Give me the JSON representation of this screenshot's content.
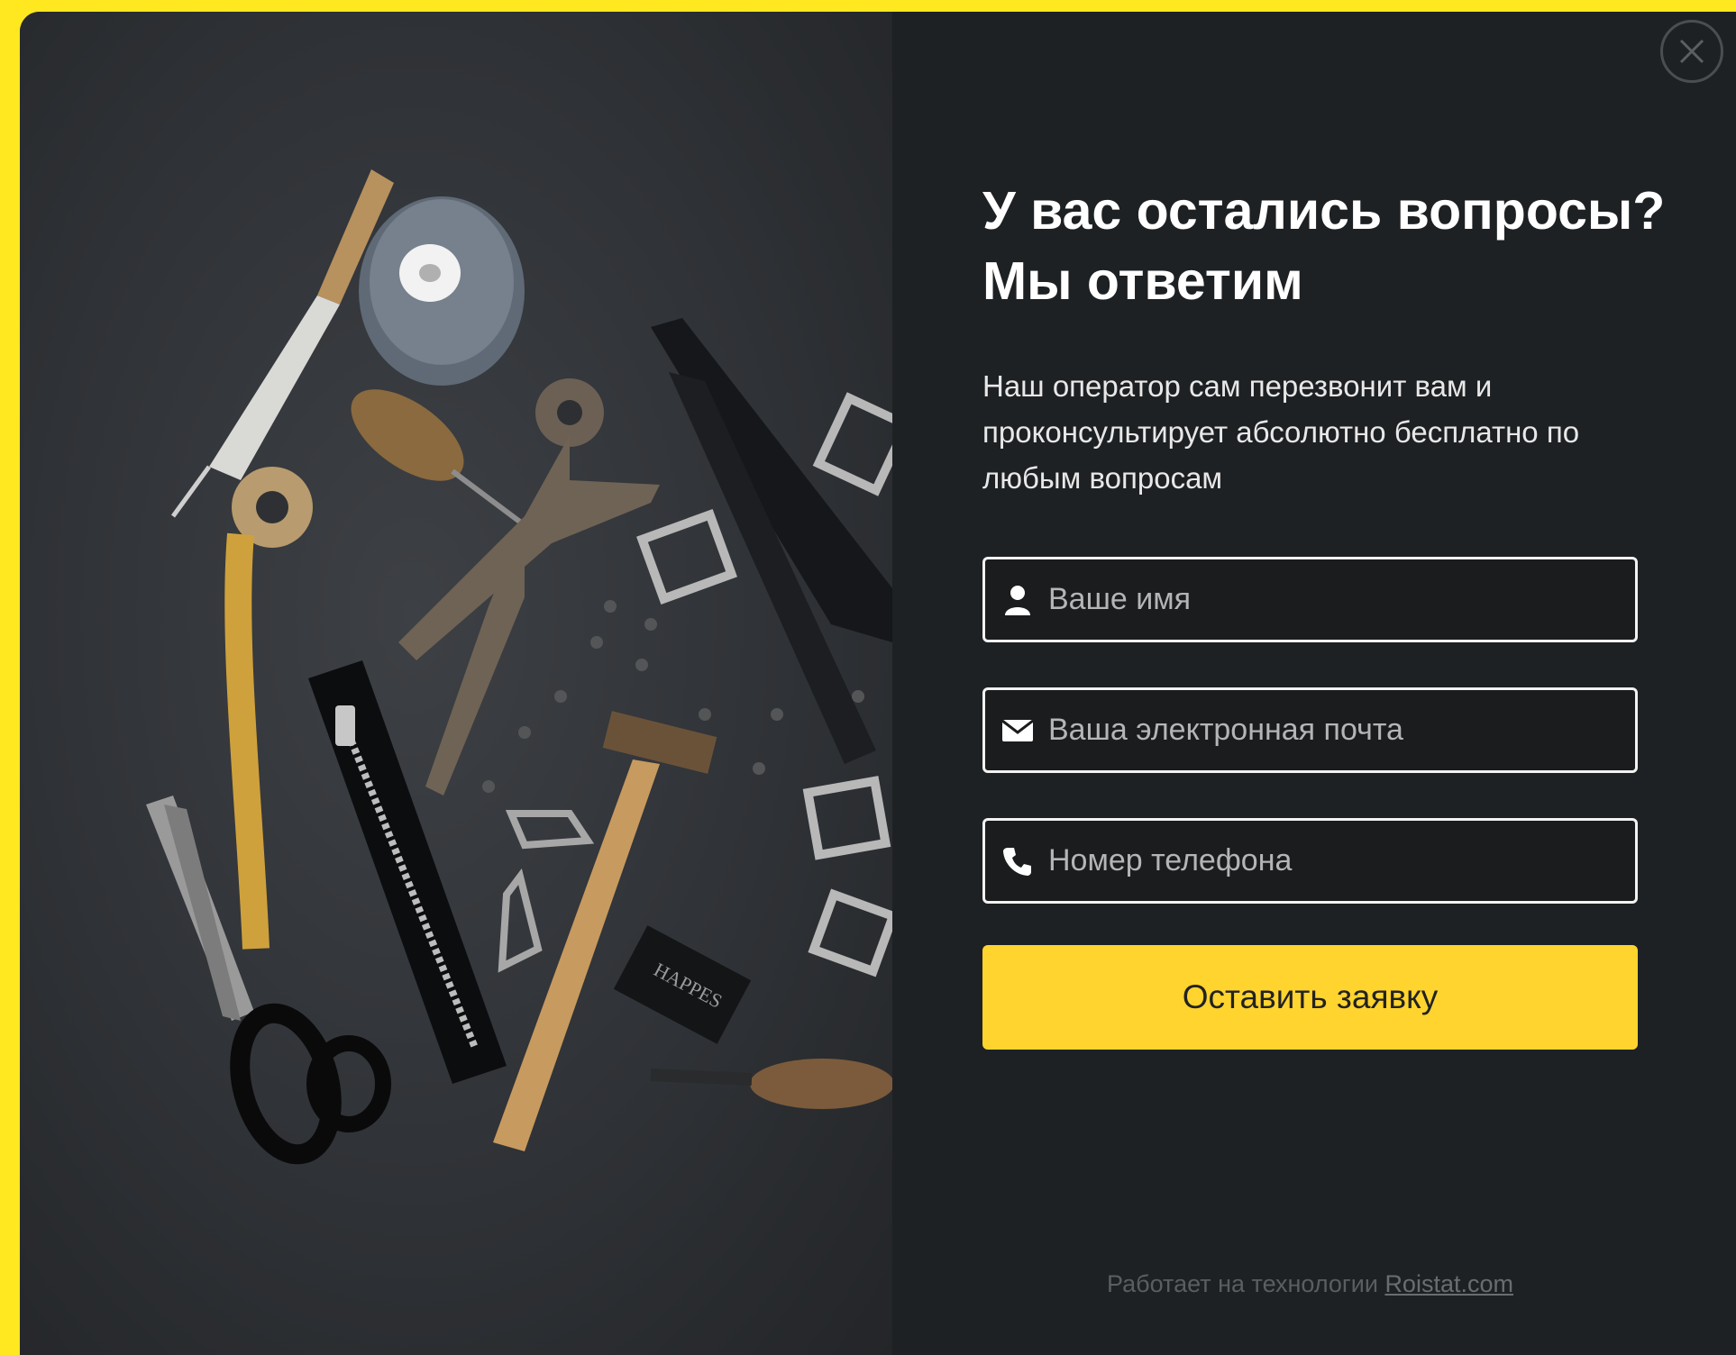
{
  "modal": {
    "title": "У вас остались вопросы? Мы ответим",
    "description": "Наш оператор сам перезвонит вам и проконсультирует абсолютно бесплатно по любым вопросам",
    "fields": [
      {
        "placeholder": "Ваше имя",
        "icon": "user-icon"
      },
      {
        "placeholder": "Ваша электронная почта",
        "icon": "envelope-icon"
      },
      {
        "placeholder": "Номер телефона",
        "icon": "phone-icon"
      }
    ],
    "submit_label": "Оставить заявку",
    "footer_text": "Работает на технологии",
    "footer_link": "Roistat.com",
    "close_icon": "close-icon",
    "photo_label": "HAPPES"
  },
  "colors": {
    "page_background": "#ffe81f",
    "panel_background": "#1e2123",
    "accent": "#ffd42e"
  }
}
